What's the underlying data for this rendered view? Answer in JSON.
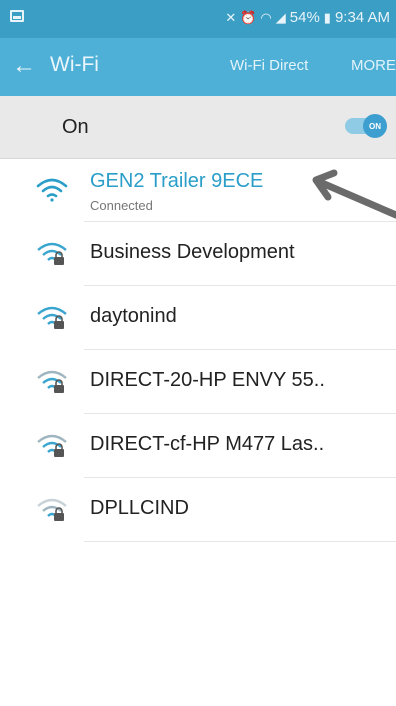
{
  "status_bar": {
    "battery": "54%",
    "time": "9:34 AM"
  },
  "app_bar": {
    "title": "Wi-Fi",
    "wifi_direct": "Wi-Fi Direct",
    "more": "MORE"
  },
  "master_toggle": {
    "label": "On",
    "state_text": "ON"
  },
  "networks": [
    {
      "name": "GEN2 Trailer 9ECE",
      "status": "Connected",
      "secured": false
    },
    {
      "name": "Business Development",
      "secured": true
    },
    {
      "name": "daytonind",
      "secured": true
    },
    {
      "name": "DIRECT-20-HP ENVY 55..",
      "secured": true
    },
    {
      "name": "DIRECT-cf-HP M477 Las..",
      "secured": true
    },
    {
      "name": "DPLLCIND",
      "secured": true
    }
  ],
  "colors": {
    "status_bar": "#3b9ec4",
    "app_bar": "#4eb0d6",
    "accent": "#2a9ec9"
  }
}
